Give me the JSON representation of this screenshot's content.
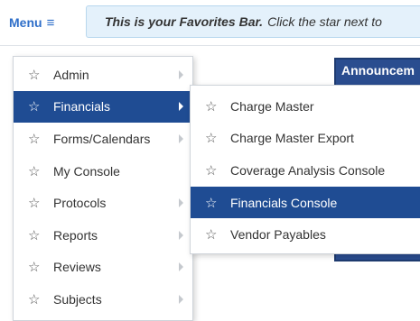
{
  "topbar": {
    "menu_label": "Menu",
    "menu_icon": "≡",
    "favorites_bold": "This is your Favorites Bar.",
    "favorites_rest": "Click the star next to"
  },
  "announcement": {
    "title": "Announcem"
  },
  "main_menu": {
    "star": "☆",
    "items": [
      {
        "label": "Admin",
        "has_submenu": true
      },
      {
        "label": "Financials",
        "has_submenu": true,
        "active": true
      },
      {
        "label": "Forms/Calendars",
        "has_submenu": true
      },
      {
        "label": "My Console",
        "has_submenu": false
      },
      {
        "label": "Protocols",
        "has_submenu": true
      },
      {
        "label": "Reports",
        "has_submenu": true
      },
      {
        "label": "Reviews",
        "has_submenu": true
      },
      {
        "label": "Subjects",
        "has_submenu": true
      }
    ]
  },
  "financials_submenu": {
    "star": "☆",
    "items": [
      {
        "label": "Charge Master"
      },
      {
        "label": "Charge Master Export"
      },
      {
        "label": "Coverage Analysis Console"
      },
      {
        "label": "Financials Console",
        "active": true
      },
      {
        "label": "Vendor Payables"
      }
    ]
  },
  "colors": {
    "accent": "#1f4c93",
    "link": "#2f6fc9",
    "favbar_bg": "#e4f1fb",
    "announcement_bg": "#2a4d8f"
  }
}
